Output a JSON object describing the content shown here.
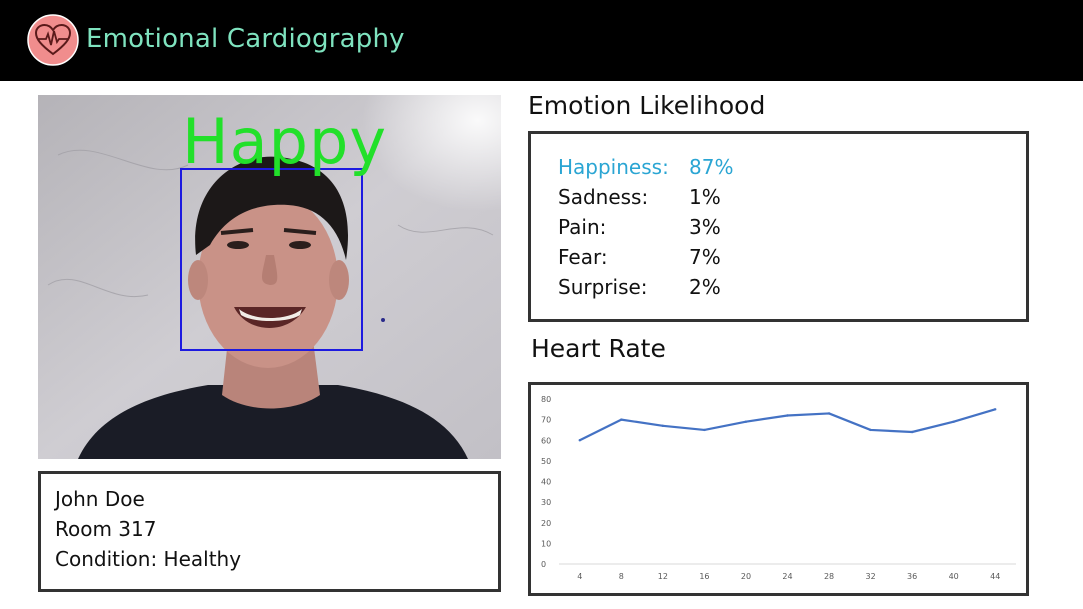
{
  "header": {
    "title": "Emotional Cardiography",
    "logo_icon": "heart-pulse-icon",
    "background": "#000000",
    "title_color": "#7fe3bf"
  },
  "camera": {
    "detected_emotion": "Happy",
    "overlay_color": "#22e02a",
    "face_box_color": "#1d1ae0"
  },
  "patient": {
    "name": "John Doe",
    "room": "Room 317",
    "condition": "Condition: Healthy"
  },
  "emotion_panel": {
    "title": "Emotion Likelihood",
    "highlight_color": "#2aa5d3",
    "items": [
      {
        "label": "Happiness:",
        "value": "87%"
      },
      {
        "label": "Sadness:",
        "value": "1%"
      },
      {
        "label": "Pain:",
        "value": "3%"
      },
      {
        "label": "Fear:",
        "value": "7%"
      },
      {
        "label": "Surprise:",
        "value": "2%"
      }
    ]
  },
  "heart_rate_panel": {
    "title": "Heart Rate"
  },
  "chart_data": {
    "type": "line",
    "x": [
      4,
      8,
      12,
      16,
      20,
      24,
      28,
      32,
      36,
      40,
      44
    ],
    "series": [
      {
        "values": [
          60,
          70,
          67,
          65,
          69,
          72,
          73,
          65,
          64,
          69,
          75
        ],
        "color": "#4472c4"
      }
    ],
    "xticks": [
      "4",
      "8",
      "12",
      "16",
      "20",
      "24",
      "28",
      "32",
      "36",
      "40",
      "44"
    ],
    "yticks": [
      "0",
      "10",
      "20",
      "30",
      "40",
      "50",
      "60",
      "70",
      "80"
    ],
    "ylim": [
      0,
      80
    ],
    "title": "",
    "xlabel": "",
    "ylabel": "",
    "grid": false
  }
}
